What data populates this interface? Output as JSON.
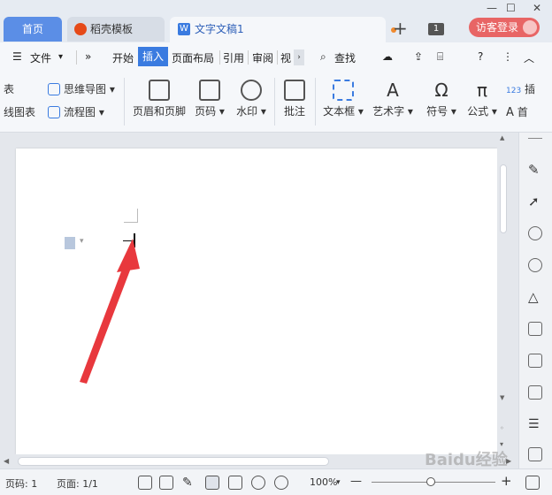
{
  "window": {
    "controls": {
      "minimize": "—",
      "maximize": "☐",
      "close": "✕"
    }
  },
  "tabs": {
    "home": "首页",
    "daoke": "稻壳模板",
    "doc": "文字文稿1",
    "new_tab": "+",
    "window_count": "1",
    "visitor_login": "访客登录"
  },
  "menu": {
    "file": "文件",
    "more": "»",
    "items": [
      "开始",
      "插入",
      "页面布局",
      "引用",
      "审阅",
      "视"
    ],
    "active": "插入",
    "search": "查找",
    "help": "?"
  },
  "ribbon": {
    "left_top": "表",
    "left_bottom": "线图表",
    "mindmap": "思维导图",
    "flowchart": "流程图",
    "header_footer": "页眉和页脚",
    "page_number": "页码",
    "watermark": "水印",
    "comment": "批注",
    "textbox": "文本框",
    "wordart": "艺术字",
    "symbol": "符号",
    "formula": "公式",
    "insert_number": "插",
    "first_letter": "首"
  },
  "status": {
    "page_num": "页码: 1",
    "pages": "页面: 1/1",
    "zoom": "100%",
    "zoom_minus": "—",
    "zoom_plus": "+"
  },
  "watermark": {
    "text": "Baidu经验"
  },
  "colors": {
    "accent": "#3a7be0",
    "home_tab": "#5b8ee6",
    "visitor": "#e86565",
    "arrow": "#e8383d"
  }
}
